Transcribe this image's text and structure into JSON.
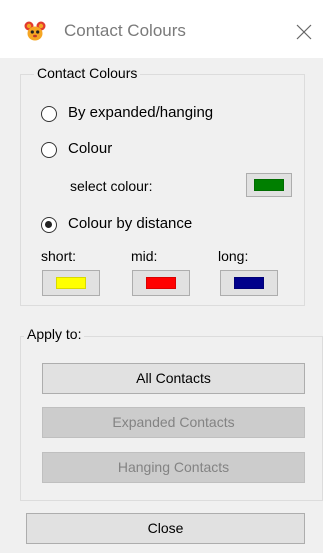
{
  "window": {
    "title": "Contact Colours",
    "app_icon": "mouse-head-icon",
    "close_icon": "close-icon"
  },
  "contact_group": {
    "legend": "Contact Colours",
    "options": [
      {
        "label": "By expanded/hanging",
        "checked": false
      },
      {
        "label": "Colour",
        "checked": false
      },
      {
        "label": "Colour by distance",
        "checked": true
      }
    ],
    "select_colour_label": "select colour:",
    "select_colour_value": "#007f00",
    "distance": {
      "short": {
        "label": "short:",
        "color": "#ffff00"
      },
      "mid": {
        "label": "mid:",
        "color": "#ff0000"
      },
      "long": {
        "label": "long:",
        "color": "#00008b"
      }
    }
  },
  "apply_group": {
    "legend": "Apply to:",
    "buttons": [
      {
        "label": "All Contacts",
        "enabled": true
      },
      {
        "label": "Expanded Contacts",
        "enabled": false
      },
      {
        "label": "Hanging Contacts",
        "enabled": false
      }
    ]
  },
  "footer": {
    "close_label": "Close"
  }
}
